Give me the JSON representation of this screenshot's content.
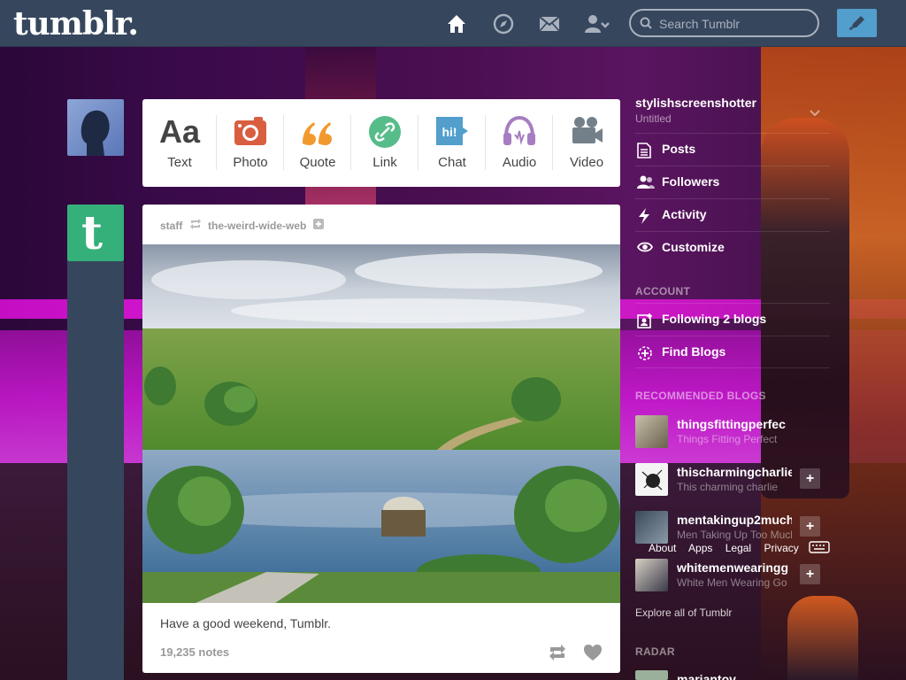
{
  "header": {
    "logo": "tumblr.",
    "search_placeholder": "Search Tumblr",
    "icons": [
      "home-icon",
      "explore-icon",
      "mail-icon",
      "account-icon"
    ],
    "compose_icon": "pencil-icon"
  },
  "post_types": [
    {
      "label": "Text",
      "icon": "text-icon",
      "color": "#444444"
    },
    {
      "label": "Photo",
      "icon": "camera-icon",
      "color": "#d95e40"
    },
    {
      "label": "Quote",
      "icon": "quote-icon",
      "color": "#f2992e"
    },
    {
      "label": "Link",
      "icon": "link-icon",
      "color": "#56bc8a"
    },
    {
      "label": "Chat",
      "icon": "chat-icon",
      "color": "#529ecc"
    },
    {
      "label": "Audio",
      "icon": "headphones-icon",
      "color": "#a77dc2"
    },
    {
      "label": "Video",
      "icon": "video-icon",
      "color": "#748089"
    }
  ],
  "post": {
    "author": "staff",
    "reblogged_from": "the-weird-wide-web",
    "caption": "Have a good weekend, Tumblr.",
    "notes": "19,235 notes"
  },
  "sidebar": {
    "blog_name": "stylishscreenshotter",
    "blog_title": "Untitled",
    "items": [
      {
        "label": "Posts",
        "icon": "posts-icon"
      },
      {
        "label": "Followers",
        "icon": "followers-icon"
      },
      {
        "label": "Activity",
        "icon": "activity-icon"
      },
      {
        "label": "Customize",
        "icon": "eye-icon"
      }
    ],
    "account_heading": "ACCOUNT",
    "account_items": [
      {
        "label": "Following 2 blogs",
        "icon": "following-icon"
      },
      {
        "label": "Find Blogs",
        "icon": "find-blogs-icon"
      }
    ],
    "recommended_heading": "RECOMMENDED BLOGS",
    "recommended": [
      {
        "name": "thingsfittingperfec",
        "desc": "Things Fitting Perfect"
      },
      {
        "name": "thischarmingcharlie",
        "desc": "This charming charlie"
      },
      {
        "name": "mentakingup2much",
        "desc": "Men Taking Up Too Much"
      },
      {
        "name": "whitemenwearingg",
        "desc": "White Men Wearing Go"
      }
    ],
    "footer_links": [
      "About",
      "Apps",
      "Legal",
      "Privacy"
    ],
    "explore": "Explore all of Tumblr",
    "radar_heading": "RADAR",
    "radar_partial": "mariantov"
  },
  "colors": {
    "header_bg": "#36465d",
    "accent": "#529ecc",
    "staff_green": "#35b07a"
  }
}
